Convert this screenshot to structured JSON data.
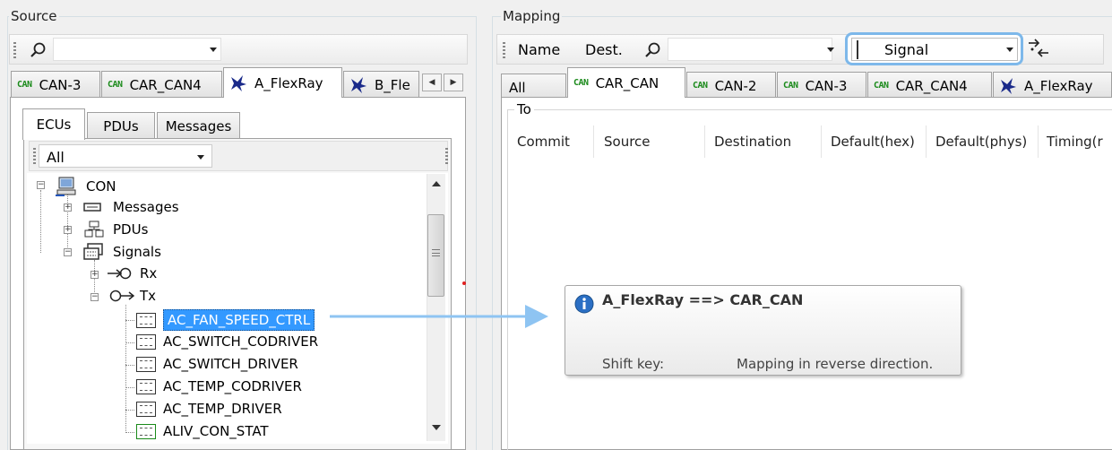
{
  "source": {
    "title": "Source",
    "search_value": "",
    "tabs": [
      "CAN-3",
      "CAR_CAN4",
      "A_FlexRay",
      "B_Fle"
    ],
    "sub_tabs": [
      "ECUs",
      "PDUs",
      "Messages"
    ],
    "filter_value": "All",
    "tree": {
      "con": "CON",
      "messages": "Messages",
      "pdus": "PDUs",
      "signals": "Signals",
      "rx": "Rx",
      "tx": "Tx",
      "signals_list": [
        "AC_FAN_SPEED_CTRL",
        "AC_SWITCH_CODRIVER",
        "AC_SWITCH_DRIVER",
        "AC_TEMP_CODRIVER",
        "AC_TEMP_DRIVER",
        "ALIV_CON_STAT"
      ]
    }
  },
  "mapping": {
    "title": "Mapping",
    "name_label": "Name",
    "dest_label": "Dest.",
    "type_value": "Signal",
    "tabs": [
      "All",
      "CAR_CAN",
      "CAN-2",
      "CAN-3",
      "CAR_CAN4",
      "A_FlexRay"
    ],
    "to_label": "To",
    "columns": [
      "Commit",
      "Source",
      "Destination",
      "Default(hex)",
      "Default(phys)",
      "Timing(r"
    ]
  },
  "tooltip": {
    "title": "A_FlexRay ==> CAR_CAN",
    "key_label": "Shift key:",
    "key_desc": "Mapping in reverse direction."
  },
  "colors": {
    "selection": "#3399ff",
    "can_green": "#1a8a1a",
    "flexray_blue": "#1a2a8a",
    "arrow": "#8ec4f2",
    "highlight_ring": "#7db8ea"
  }
}
